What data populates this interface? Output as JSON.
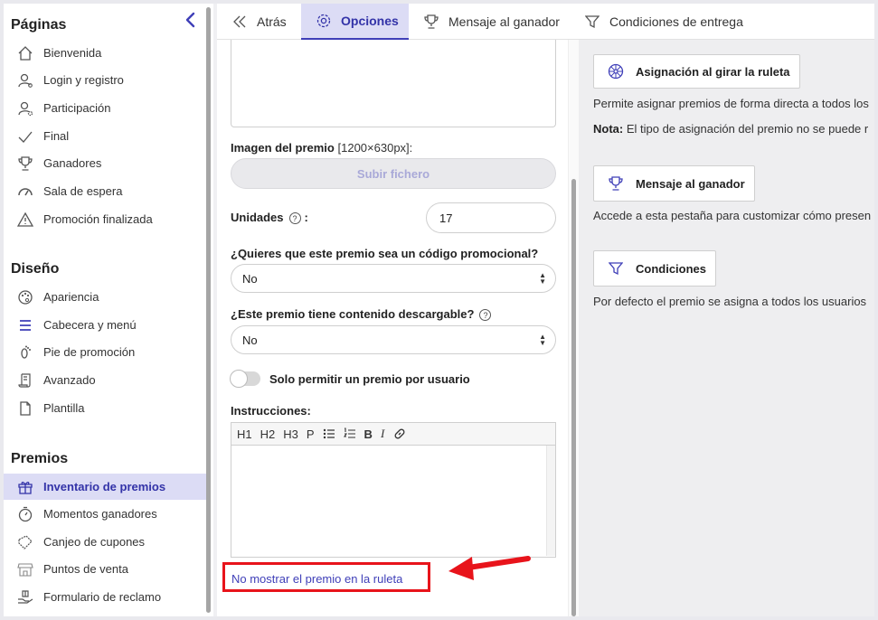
{
  "sidebar": {
    "sections": [
      {
        "title": "Páginas",
        "items": [
          {
            "label": "Bienvenida",
            "icon": "home-icon"
          },
          {
            "label": "Login y registro",
            "icon": "user-key-icon"
          },
          {
            "label": "Participación",
            "icon": "user-gear-icon"
          },
          {
            "label": "Final",
            "icon": "checkmark-icon"
          },
          {
            "label": "Ganadores",
            "icon": "trophy-icon"
          },
          {
            "label": "Sala de espera",
            "icon": "speedometer-icon"
          },
          {
            "label": "Promoción finalizada",
            "icon": "warning-icon"
          }
        ]
      },
      {
        "title": "Diseño",
        "items": [
          {
            "label": "Apariencia",
            "icon": "palette-icon"
          },
          {
            "label": "Cabecera y menú",
            "icon": "menu-icon"
          },
          {
            "label": "Pie de promoción",
            "icon": "footprint-icon"
          },
          {
            "label": "Avanzado",
            "icon": "scroll-icon"
          },
          {
            "label": "Plantilla",
            "icon": "document-icon"
          }
        ]
      },
      {
        "title": "Premios",
        "items": [
          {
            "label": "Inventario de premios",
            "icon": "gift-icon",
            "active": true
          },
          {
            "label": "Momentos ganadores",
            "icon": "stopwatch-icon"
          },
          {
            "label": "Canjeo de cupones",
            "icon": "coupon-icon"
          },
          {
            "label": "Puntos de venta",
            "icon": "store-icon"
          },
          {
            "label": "Formulario de reclamo",
            "icon": "hand-gift-icon"
          }
        ]
      }
    ]
  },
  "tabs": [
    {
      "label": "Atrás",
      "icon": "double-chevron-left-icon"
    },
    {
      "label": "Opciones",
      "icon": "gear-icon",
      "active": true
    },
    {
      "label": "Mensaje al ganador",
      "icon": "trophy-icon"
    },
    {
      "label": "Condiciones de entrega",
      "icon": "filter-icon"
    }
  ],
  "form": {
    "image_label": "Imagen del premio",
    "image_size": "[1200×630px]:",
    "upload_button": "Subir fichero",
    "units_label": "Unidades",
    "units_value": "17",
    "promo_code_label": "¿Quieres que este premio sea un código promocional?",
    "promo_code_value": "No",
    "downloadable_label": "¿Este premio tiene contenido descargable?",
    "downloadable_value": "No",
    "one_prize_toggle_label": "Solo permitir un premio por usuario",
    "one_prize_toggle_on": false,
    "instructions_label": "Instrucciones:",
    "toolbar": [
      "H1",
      "H2",
      "H3",
      "P"
    ],
    "hide_in_wheel_link": "No mostrar el premio en la ruleta"
  },
  "right_panel": {
    "assign_button": "Asignación al girar la ruleta",
    "assign_text": "Permite asignar premios de forma directa a todos los",
    "note_label": "Nota:",
    "note_text": " El tipo de asignación del premio no se puede r",
    "winner_button": "Mensaje al ganador",
    "winner_text": "Accede a esta pestaña para customizar cómo presen",
    "conditions_button": "Condiciones",
    "conditions_text": "Por defecto el premio se asigna a todos los usuarios"
  },
  "colors": {
    "accent": "#3f3fb8",
    "active_bg": "#dcdcf5",
    "highlight": "#e8141b"
  }
}
